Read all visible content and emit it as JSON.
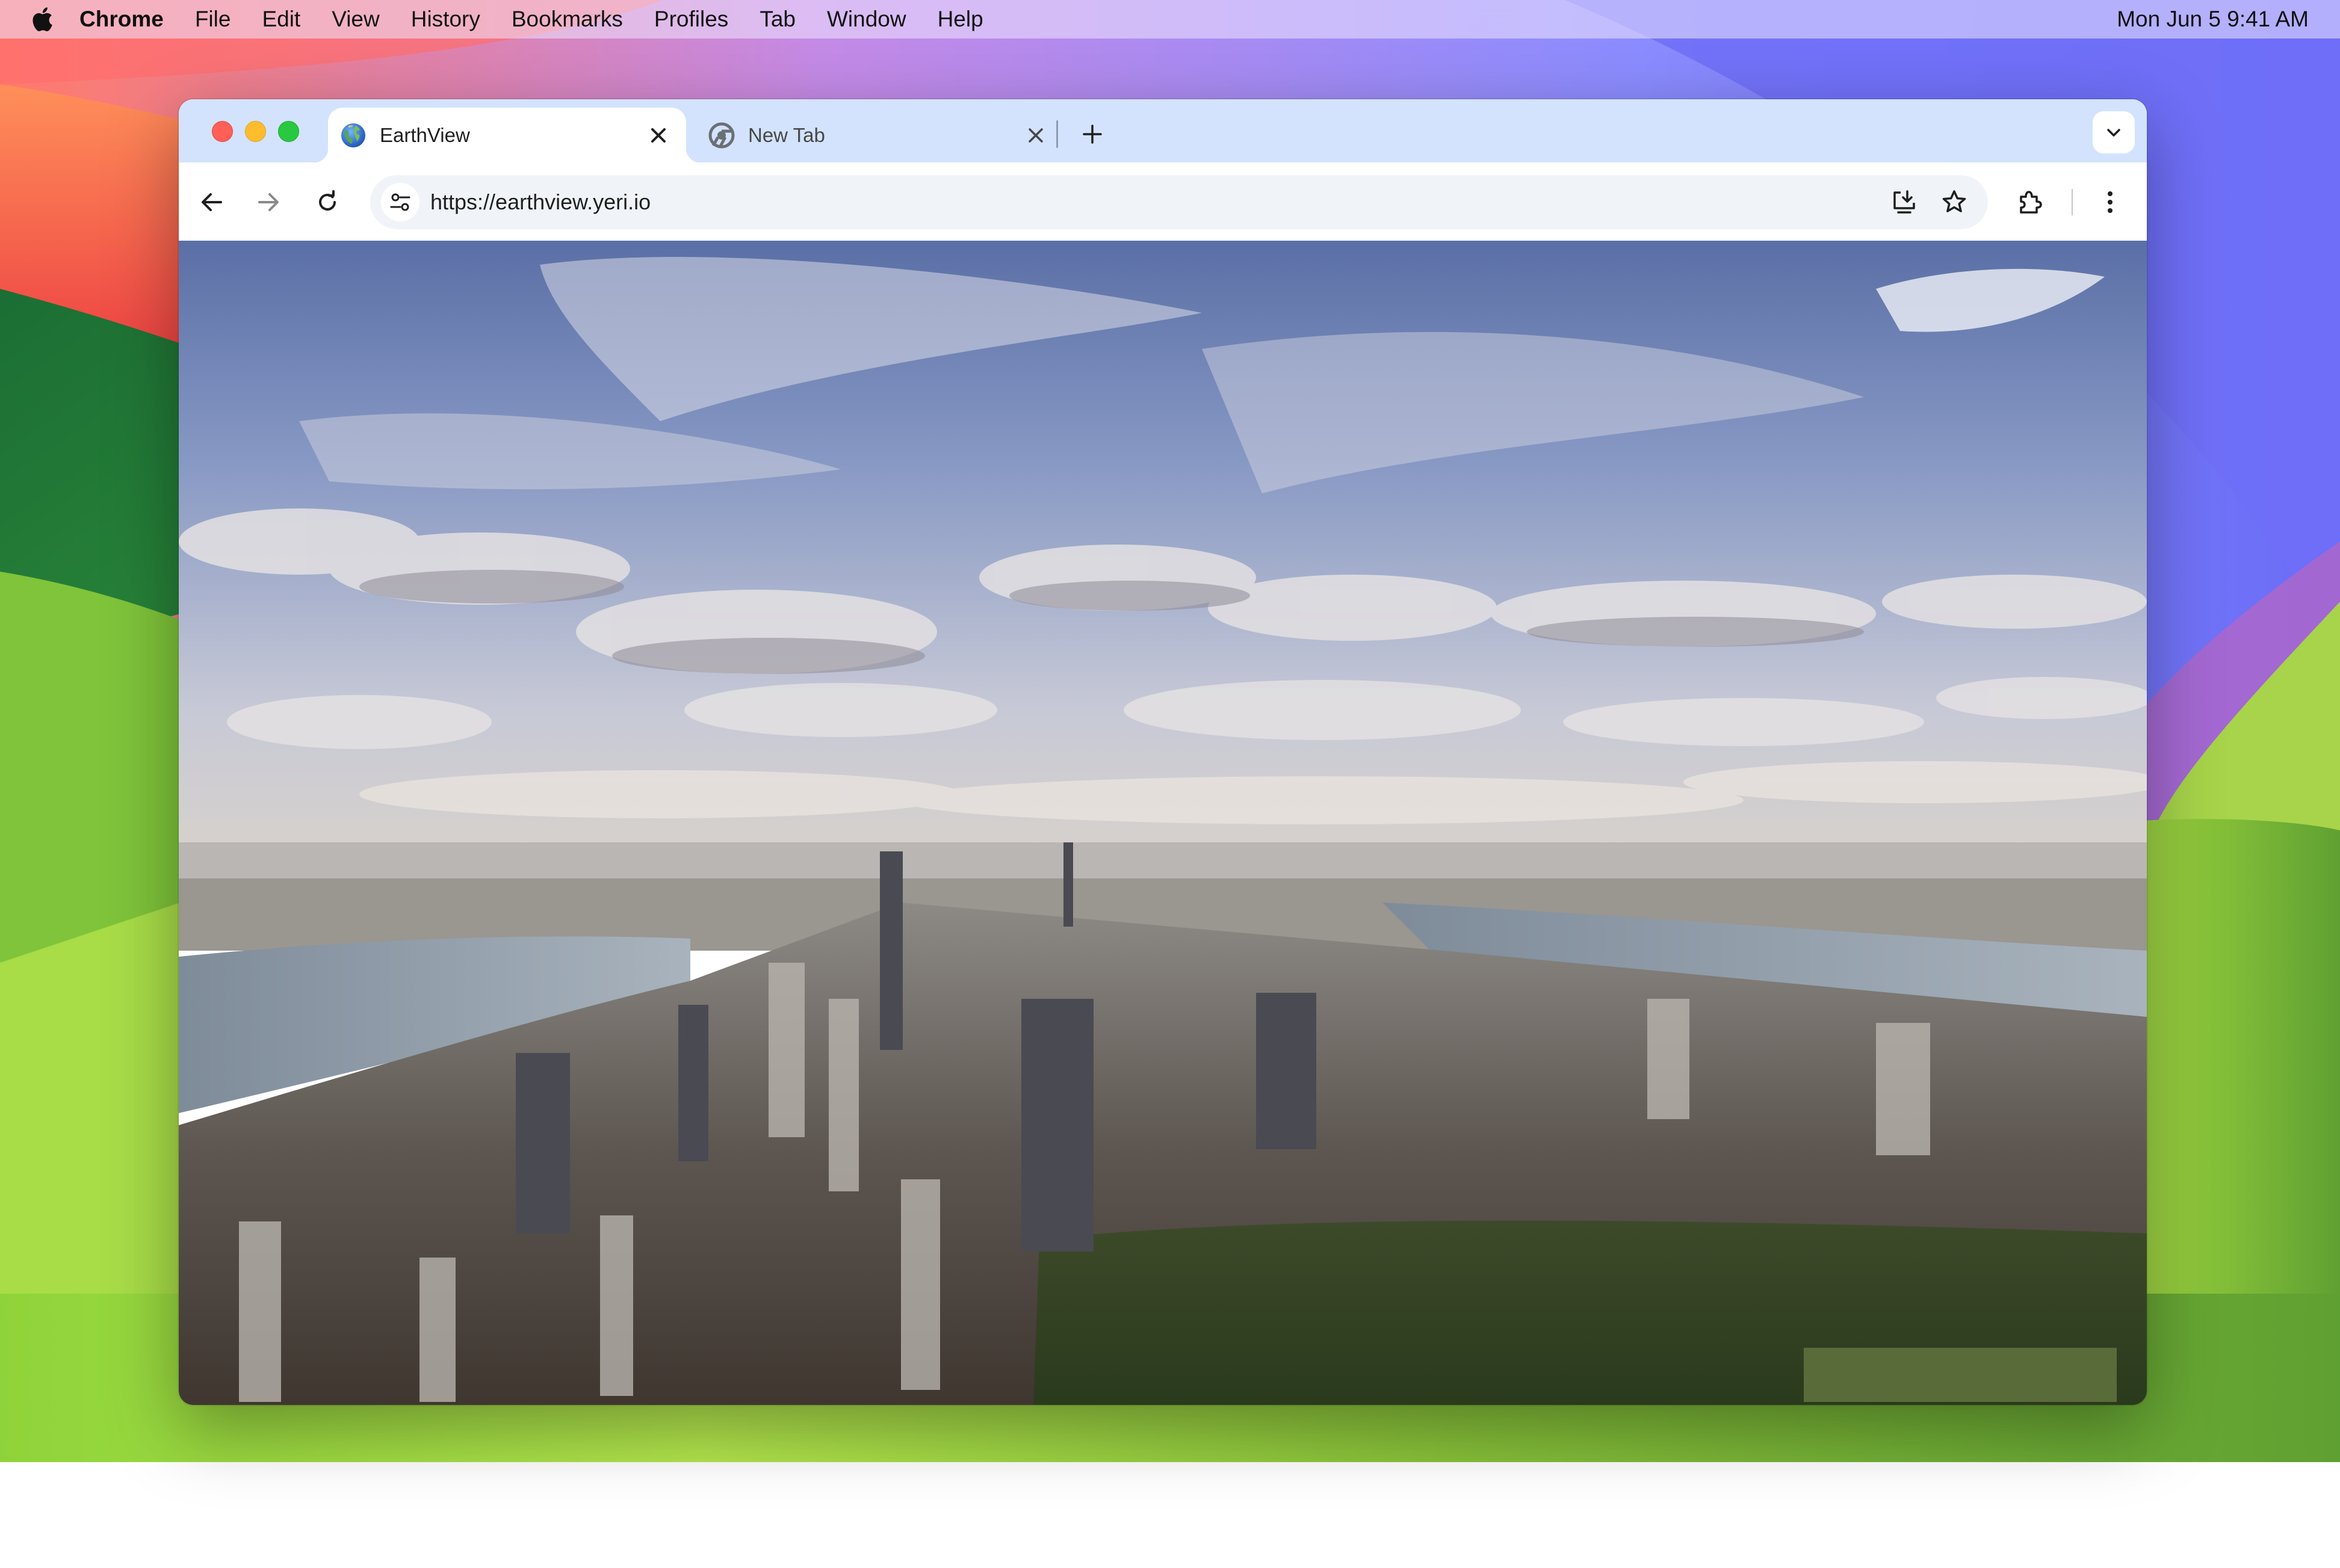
{
  "menubar": {
    "apple_icon": "apple-logo-icon",
    "app_name": "Chrome",
    "items": [
      "File",
      "Edit",
      "View",
      "History",
      "Bookmarks",
      "Profiles",
      "Tab",
      "Window",
      "Help"
    ],
    "clock": "Mon Jun 5  9:41 AM"
  },
  "browser": {
    "tabs": [
      {
        "title": "EarthView",
        "icon": "globe-favicon-icon",
        "active": true
      },
      {
        "title": "New Tab",
        "icon": "chrome-favicon-icon",
        "active": false
      }
    ],
    "toolbar": {
      "url": "https://earthview.yeri.io"
    }
  },
  "content": {
    "image": "aerial view of Manhattan skyline with Central Park"
  },
  "colors": {
    "tabstrip_bg": "#d3e3fd",
    "toolbar_bg": "#ffffff",
    "omnibox_bg": "#f0f4f9",
    "traffic_close": "#ff5f57",
    "traffic_minimize": "#febc2e",
    "traffic_maximize": "#28c840"
  }
}
